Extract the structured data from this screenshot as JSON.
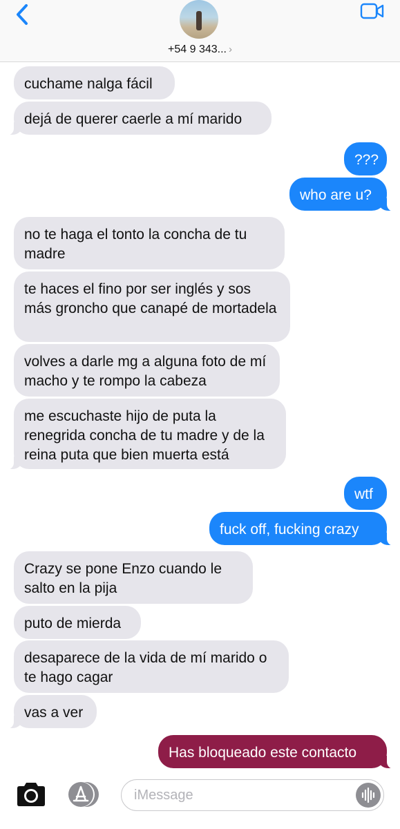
{
  "header": {
    "contact_name": "+54 9 343...",
    "chevron": "›",
    "back_icon": "chevron-left-icon",
    "video_icon": "video-camera-icon"
  },
  "messages": [
    {
      "side": "in",
      "text": "cuchame nalga fácil"
    },
    {
      "side": "in",
      "text": "dejá de querer caerle a mí marido"
    },
    {
      "side": "out",
      "text": "???"
    },
    {
      "side": "out",
      "text": "who are u?"
    },
    {
      "side": "in",
      "text": "no te haga el tonto la concha de tu madre"
    },
    {
      "side": "in",
      "text": "te haces el fino por ser inglés y sos más groncho que canapé de mortadela"
    },
    {
      "side": "in",
      "text": "volves a darle mg a alguna foto de mí macho y te rompo la cabeza"
    },
    {
      "side": "in",
      "text": "me escuchaste hijo de puta la renegrida concha de tu madre y de la reina puta que bien muerta está"
    },
    {
      "side": "out",
      "text": "wtf"
    },
    {
      "side": "out",
      "text": "fuck off, fucking crazy"
    },
    {
      "side": "in",
      "text": "Crazy se pone Enzo cuando le salto en la pija"
    },
    {
      "side": "in",
      "text": "puto de mierda"
    },
    {
      "side": "in",
      "text": "desaparece de la vida de mí marido o te hago cagar"
    },
    {
      "side": "in",
      "text": "vas a ver"
    },
    {
      "side": "blocked",
      "text": "Has bloqueado este contacto"
    }
  ],
  "composer": {
    "placeholder": "iMessage",
    "camera_icon": "camera-icon",
    "apps_icon": "app-store-icon",
    "audio_icon": "audio-waveform-icon"
  },
  "colors": {
    "incoming_bubble": "#e6e5eb",
    "outgoing_bubble": "#1b86fb",
    "blocked_bubble": "#8e1d48",
    "accent": "#1b86fb"
  }
}
